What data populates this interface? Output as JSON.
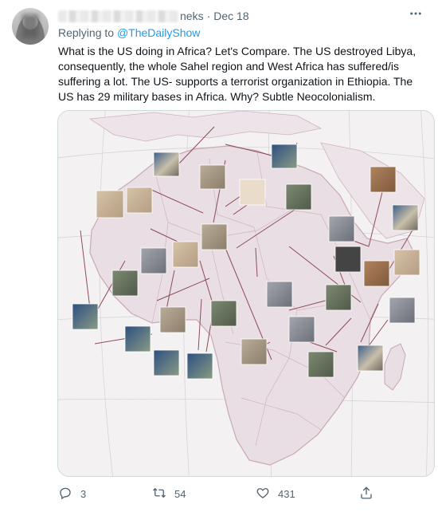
{
  "tweet": {
    "author_suffix": "neks",
    "separator": "·",
    "date": "Dec 18",
    "reply_prefix": "Replying to ",
    "reply_to": "@TheDailyShow",
    "text": "What is the US doing in Africa? Let's Compare. The US destroyed Libya, consequently, the whole Sahel region and West Africa has suffered/is suffering a lot. The US- supports a terrorist organization in Ethiopia. The US has 29 military bases in Africa. Why? Subtle Neocolonialism.",
    "more_icon": "more-horizontal-icon"
  },
  "media": {
    "description_icon": "africa-map-image",
    "colors": {
      "land": "#e7dde2",
      "sea": "#f4f1f2",
      "border": "#c9a9b4",
      "grid": "#d3d3d6",
      "pin": "#8f4a5b"
    }
  },
  "actions": {
    "reply_count": "3",
    "retweet_count": "54",
    "like_count": "431",
    "reply_icon": "reply-icon",
    "retweet_icon": "retweet-icon",
    "like_icon": "heart-icon",
    "share_icon": "share-icon",
    "icon_color": "#536471"
  }
}
